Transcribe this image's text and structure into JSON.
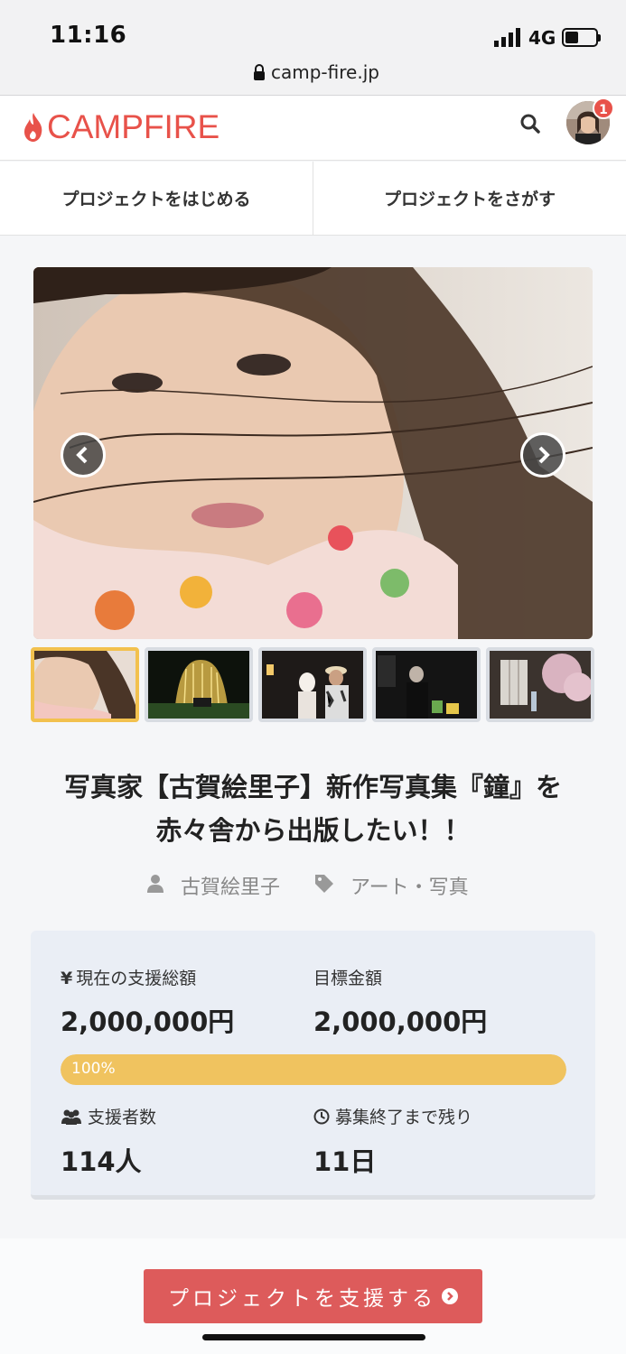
{
  "status_bar": {
    "time": "11:16",
    "network": "4G",
    "battery_level": 0.45
  },
  "browser": {
    "url": "camp-fire.jp"
  },
  "header": {
    "logo_text": "CAMPFIRE",
    "notification_count": "1"
  },
  "nav": {
    "tabs": [
      {
        "label": "プロジェクトをはじめる"
      },
      {
        "label": "プロジェクトをさがす"
      }
    ]
  },
  "project": {
    "title_line1": "写真家【古賀絵里子】新作写真集『鐘』を",
    "title_line2": "赤々舎から出版したい！！",
    "owner": "古賀絵里子",
    "category": "アート・写真"
  },
  "stats": {
    "current_label": "現在の支援総額",
    "current_value": "2,000,000円",
    "goal_label": "目標金額",
    "goal_value": "2,000,000円",
    "progress_text": "100%",
    "progress_fraction": 1.0,
    "backers_label": "支援者数",
    "backers_value": "114人",
    "remaining_label": "募集終了まで残り",
    "remaining_value": "11日"
  },
  "cta": {
    "label": "プロジェクトを支援する"
  },
  "colors": {
    "brand": "#e8524a",
    "progress": "#f0c35f",
    "cta": "#dd5b5b",
    "active_thumb": "#f2c14e"
  }
}
